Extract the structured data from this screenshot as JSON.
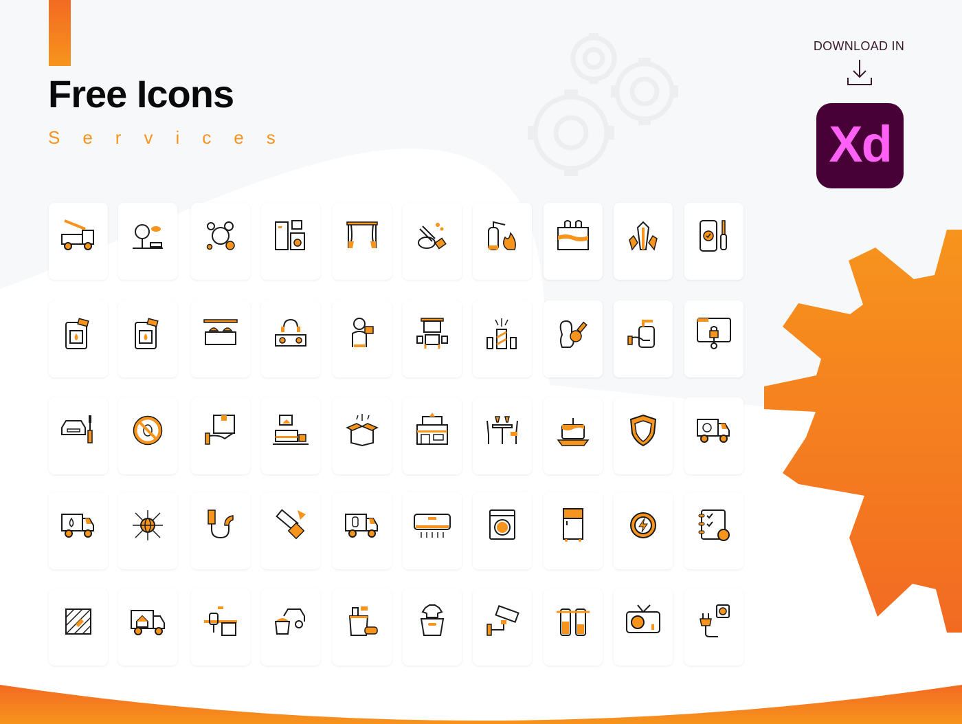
{
  "header": {
    "title": "Free Icons",
    "subtitle": "Services"
  },
  "download": {
    "label": "DOWNLOAD IN",
    "icon": "download-tray-icon",
    "app_badge": "Xd",
    "app_name": "Adobe XD"
  },
  "colors": {
    "accent_orange": "#f7941d",
    "accent_deep_orange": "#f26a22",
    "xd_background": "#470137",
    "xd_text": "#ff61f6",
    "card_background": "#ffffff",
    "page_background": "#f6f8f9",
    "icon_stroke": "#1a1a1a"
  },
  "icon_rows": [
    [
      "tow-truck-icon",
      "park-icon",
      "soap-bubbles-icon",
      "home-appliances-icon",
      "curtains-icon",
      "hand-washing-icon",
      "fire-extinguisher-icon",
      "swimming-pool-icon",
      "crystals-icon",
      "phone-repair-icon"
    ],
    [
      "oil-canister-icon",
      "fuel-canister-icon",
      "catering-buffet-icon",
      "dj-mixer-icon",
      "photographer-icon",
      "meeting-room-icon",
      "fireworks-icon",
      "pet-grooming-icon",
      "hand-soap-icon",
      "web-security-icon"
    ],
    [
      "car-repair-icon",
      "pest-control-icon",
      "package-delivery-icon",
      "bedroom-icon",
      "surprise-box-icon",
      "shop-icon",
      "restaurant-table-icon",
      "birthday-cake-icon",
      "shield-icon",
      "flower-delivery-truck-icon"
    ],
    [
      "water-delivery-truck-icon",
      "global-network-icon",
      "plumbing-pipe-icon",
      "tiling-tools-icon",
      "gas-delivery-truck-icon",
      "air-conditioner-icon",
      "washing-machine-icon",
      "refrigerator-icon",
      "power-settings-icon",
      "schedule-checklist-icon"
    ],
    [
      "parquet-floor-icon",
      "moving-truck-icon",
      "office-desk-icon",
      "car-wash-icon",
      "cleaning-supplies-icon",
      "laundry-basket-icon",
      "security-camera-icon",
      "water-filter-icon",
      "television-icon",
      "power-plug-icon"
    ]
  ]
}
